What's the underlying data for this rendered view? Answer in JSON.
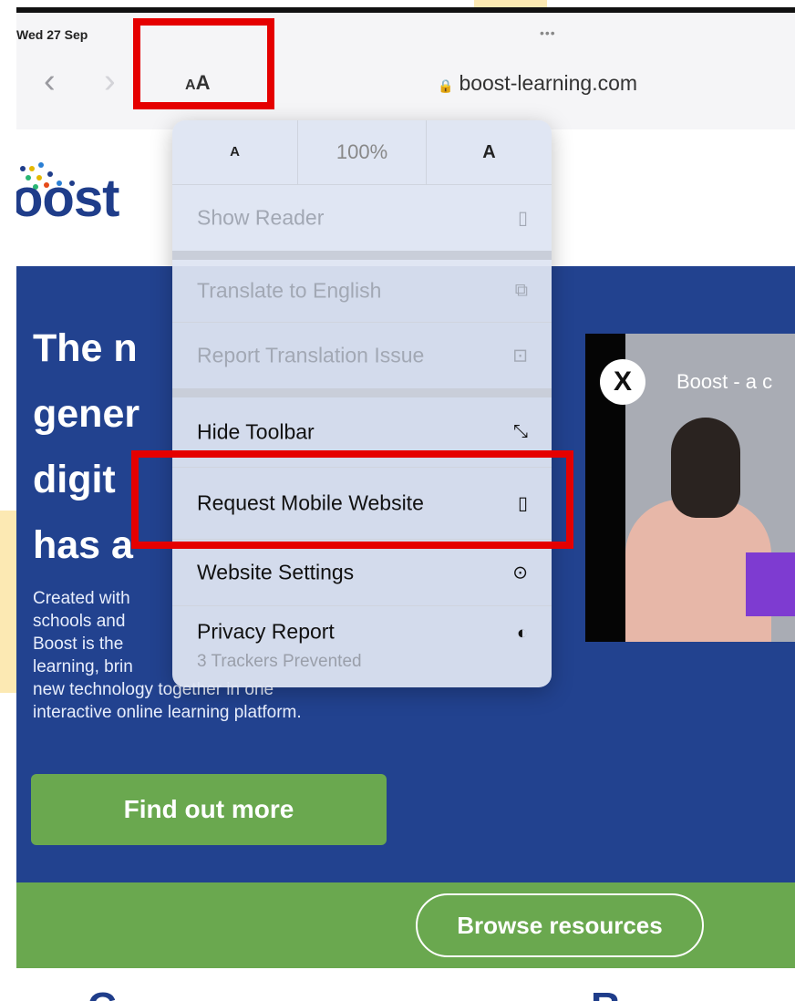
{
  "status_bar": {
    "time": "Wed 27 Sep",
    "dots": "•••"
  },
  "toolbar": {
    "back_glyph": "‹",
    "forward_glyph": "›",
    "aa_small": "A",
    "aa_large": "A",
    "url": "boost-learning.com"
  },
  "site": {
    "logo_text": "oost",
    "hero_title": [
      "The n",
      "gener",
      "digit",
      "has a"
    ],
    "hero_desc": [
      "Created with",
      "schools and",
      "Boost is the",
      "learning, brin",
      "new technology together in one",
      "interactive online learning platform."
    ],
    "find_out_more": "Find out more",
    "video_title": "Boost - a c",
    "video_logo_glyph": "X",
    "browse_resources": "Browse resources",
    "bottom_left": "C",
    "bottom_right": "R"
  },
  "menu": {
    "zoom": {
      "smaller": "A",
      "percent": "100%",
      "larger": "A"
    },
    "items": [
      {
        "label": "Show Reader",
        "icon": "reader-icon",
        "glyph": "▯",
        "enabled": false
      },
      {
        "label": "Translate to English",
        "icon": "translate-icon",
        "glyph": "⧉",
        "enabled": false
      },
      {
        "label": "Report Translation Issue",
        "icon": "report-bubble-icon",
        "glyph": "⊡",
        "enabled": false
      },
      {
        "label": "Hide Toolbar",
        "icon": "resize-arrows-icon",
        "glyph": "⤡",
        "enabled": true
      },
      {
        "label": "Request Mobile Website",
        "icon": "phone-icon",
        "glyph": "▯",
        "enabled": true
      },
      {
        "label": "Website Settings",
        "icon": "settings-circle-icon",
        "glyph": "⊙",
        "enabled": true
      },
      {
        "label": "Privacy Report",
        "sublabel": "3 Trackers Prevented",
        "icon": "shield-icon",
        "glyph": "◐",
        "enabled": true
      }
    ]
  },
  "colors": {
    "highlight": "#e50000",
    "hero_blue": "#22428f",
    "brand_green": "#6aa84f",
    "menu_bg": "#dee4f2"
  }
}
